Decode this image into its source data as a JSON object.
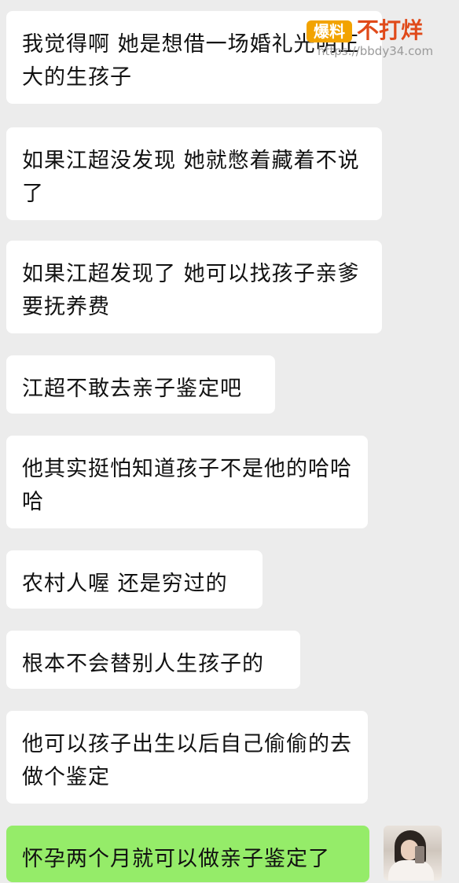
{
  "messages": [
    {
      "text": "我觉得啊  她是想借一场婚礼光明正大的生孩子",
      "sender": "other"
    },
    {
      "text": "如果江超没发现  她就憋着藏着不说了",
      "sender": "other"
    },
    {
      "text": "如果江超发现了  她可以找孩子亲爹  要抚养费",
      "sender": "other"
    },
    {
      "text": "江超不敢去亲子鉴定吧",
      "sender": "other"
    },
    {
      "text": "他其实挺怕知道孩子不是他的哈哈哈",
      "sender": "other"
    },
    {
      "text": "农村人喔  还是穷过的",
      "sender": "other"
    },
    {
      "text": "根本不会替别人生孩子的",
      "sender": "other"
    },
    {
      "text": "他可以孩子出生以后自己偷偷的去做个鉴定",
      "sender": "other"
    },
    {
      "text": "怀孕两个月就可以做亲子鉴定了",
      "sender": "self"
    }
  ],
  "watermark": {
    "logo": "爆料",
    "brand": "不打烊",
    "url": "https://bbdy34.com"
  },
  "colors": {
    "background": "#ececec",
    "received_bubble": "#ffffff",
    "sent_bubble": "#95ec69"
  }
}
